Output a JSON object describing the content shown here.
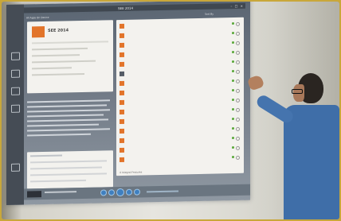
{
  "app": {
    "window_title": "SEE 2014",
    "window_controls": "– □ ×",
    "name": "SEE 2014"
  },
  "toolbar": {
    "nav": "All Apps  On Device",
    "sort": "Sort By"
  },
  "footer_left": "2 Categories",
  "footer_list": "4 Integral Features",
  "colors": {
    "accent": "#e2742a",
    "ok": "#5aa83a",
    "chrome": "#3f4750"
  }
}
